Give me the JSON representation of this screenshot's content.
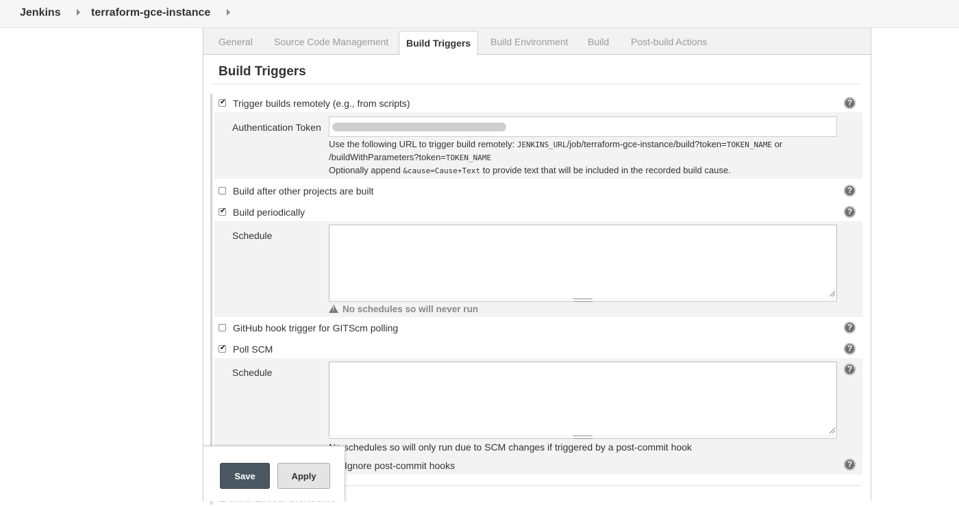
{
  "breadcrumb": {
    "items": [
      "Jenkins",
      "terraform-gce-instance"
    ]
  },
  "tabs": [
    {
      "label": "General",
      "active": false
    },
    {
      "label": "Source Code Management",
      "active": false
    },
    {
      "label": "Build Triggers",
      "active": true
    },
    {
      "label": "Build Environment",
      "active": false
    },
    {
      "label": "Build",
      "active": false
    },
    {
      "label": "Post-build Actions",
      "active": false
    }
  ],
  "section": {
    "title": "Build Triggers"
  },
  "triggers": {
    "remote": {
      "label": "Trigger builds remotely (e.g., from scripts)",
      "checked": true,
      "token_label": "Authentication Token",
      "token_value": "",
      "note1_prefix": "Use the following URL to trigger build remotely: ",
      "note1_code1": "JENKINS_URL",
      "note1_middle": "/job/terraform-gce-instance/build?token=",
      "note1_code2": "TOKEN_NAME",
      "note1_suffix": " or",
      "note2_prefix": "/buildWithParameters?token=",
      "note2_code": "TOKEN_NAME",
      "note3_prefix": "Optionally append ",
      "note3_code": "&cause=Cause+Text",
      "note3_suffix": " to provide text that will be included in the recorded build cause."
    },
    "after_other": {
      "label": "Build after other projects are built",
      "checked": false
    },
    "periodic": {
      "label": "Build periodically",
      "checked": true,
      "schedule_label": "Schedule",
      "schedule_value": "",
      "warning": "No schedules so will never run"
    },
    "github_hook": {
      "label": "GitHub hook trigger for GITScm polling",
      "checked": false
    },
    "poll_scm": {
      "label": "Poll SCM",
      "checked": true,
      "schedule_label": "Schedule",
      "schedule_value": "",
      "note": "No schedules so will only run due to SCM changes if triggered by a post-commit hook",
      "ignore_label": "Ignore post-commit hooks",
      "ignore_checked": false
    }
  },
  "help_icon_glyph": "?",
  "next_section_peek": "Build Environment",
  "savebar": {
    "save_label": "Save",
    "apply_label": "Apply"
  }
}
